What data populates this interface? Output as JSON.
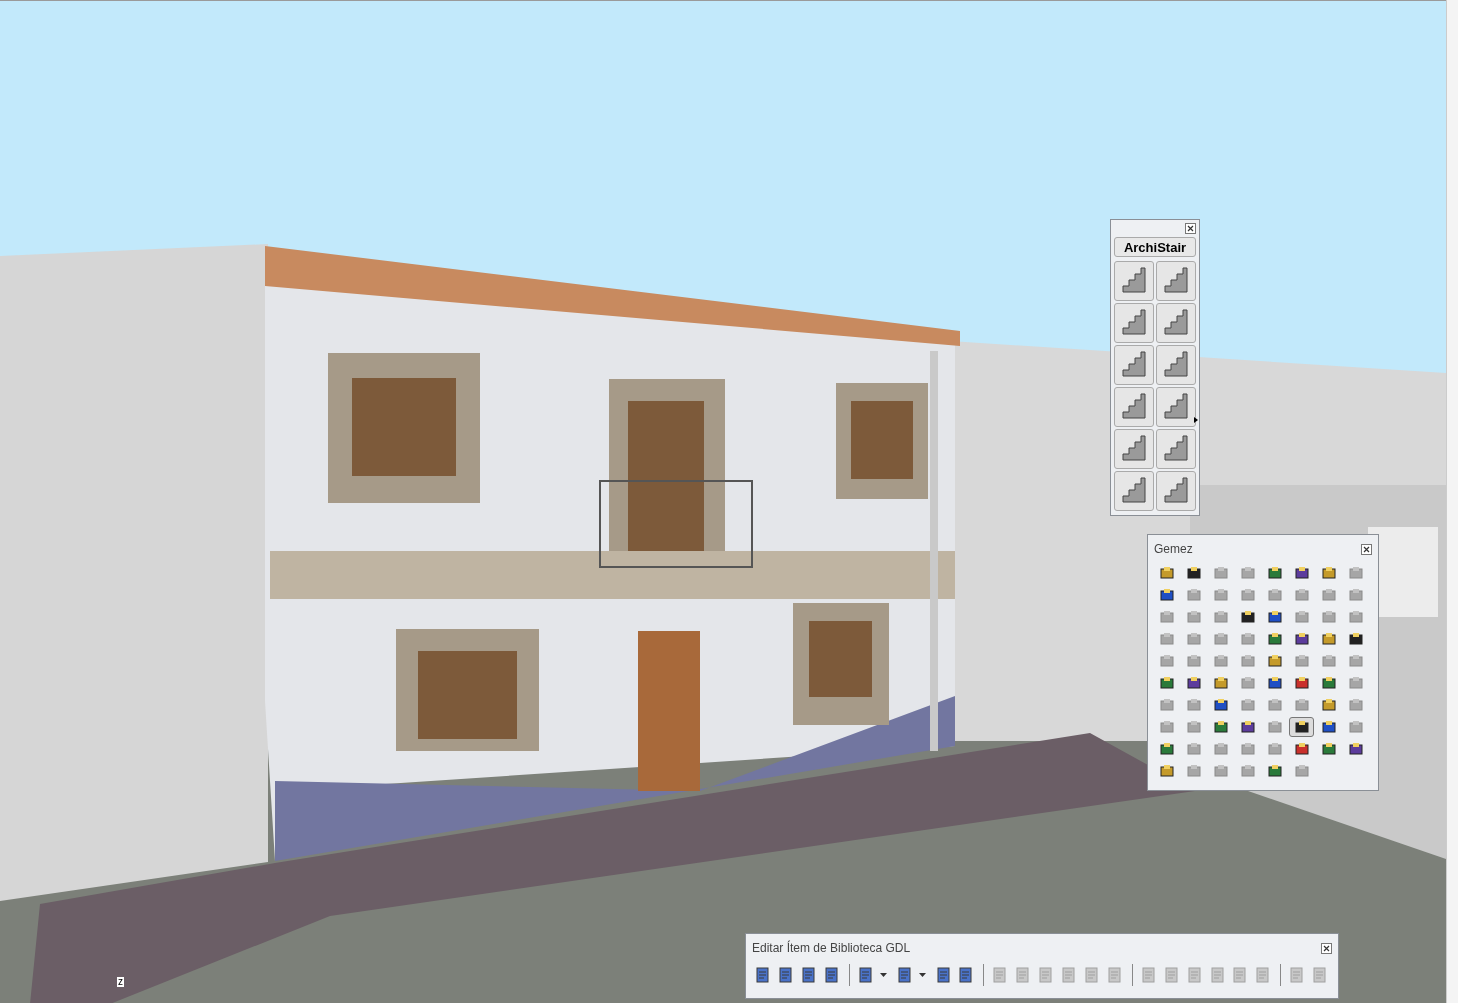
{
  "viewport": {
    "axis_label": "z"
  },
  "archistair_palette": {
    "title": "ArchiStair",
    "buttons": [
      {
        "submenu": false
      },
      {
        "submenu": false
      },
      {
        "submenu": false
      },
      {
        "submenu": false
      },
      {
        "submenu": false
      },
      {
        "submenu": false
      },
      {
        "submenu": false
      },
      {
        "submenu": true
      },
      {
        "submenu": false
      },
      {
        "submenu": false
      },
      {
        "submenu": false
      },
      {
        "submenu": false
      }
    ]
  },
  "gemez_palette": {
    "title": "Gemez",
    "rows": [
      [
        {
          "disabled": false,
          "pressed": false
        },
        {
          "disabled": false,
          "pressed": false
        },
        {
          "disabled": true,
          "pressed": false
        },
        {
          "disabled": true,
          "pressed": false
        },
        {
          "disabled": false,
          "pressed": false
        },
        {
          "disabled": false,
          "pressed": false
        },
        {
          "disabled": false,
          "pressed": false
        },
        {
          "disabled": true,
          "pressed": false
        }
      ],
      [
        {
          "disabled": false,
          "pressed": false
        },
        {
          "disabled": true,
          "pressed": false
        },
        {
          "disabled": true,
          "pressed": false
        },
        {
          "disabled": true,
          "pressed": false
        },
        {
          "disabled": true,
          "pressed": false
        },
        {
          "disabled": true,
          "pressed": false
        },
        {
          "disabled": true,
          "pressed": false
        },
        {
          "disabled": true,
          "pressed": false
        }
      ],
      [
        {
          "disabled": true,
          "pressed": false
        },
        {
          "disabled": true,
          "pressed": false
        },
        {
          "disabled": true,
          "pressed": false
        },
        {
          "disabled": false,
          "pressed": false
        },
        {
          "disabled": false,
          "pressed": false
        },
        {
          "disabled": true,
          "pressed": false
        },
        {
          "disabled": true,
          "pressed": false
        },
        {
          "disabled": true,
          "pressed": false
        }
      ],
      [
        {
          "disabled": true,
          "pressed": false
        },
        {
          "disabled": true,
          "pressed": false
        },
        {
          "disabled": true,
          "pressed": false
        },
        {
          "disabled": true,
          "pressed": false
        },
        {
          "disabled": false,
          "pressed": false
        },
        {
          "disabled": false,
          "pressed": false
        },
        {
          "disabled": false,
          "pressed": false
        },
        {
          "disabled": false,
          "pressed": false
        }
      ],
      [
        {
          "disabled": true,
          "pressed": false
        },
        {
          "disabled": true,
          "pressed": false
        },
        {
          "disabled": true,
          "pressed": false
        },
        {
          "disabled": true,
          "pressed": false
        },
        {
          "disabled": false,
          "pressed": false
        },
        {
          "disabled": true,
          "pressed": false
        },
        {
          "disabled": true,
          "pressed": false
        },
        {
          "disabled": true,
          "pressed": false
        }
      ],
      [
        {
          "disabled": false,
          "pressed": false
        },
        {
          "disabled": false,
          "pressed": false
        },
        {
          "disabled": false,
          "pressed": false
        },
        {
          "disabled": true,
          "pressed": false
        },
        {
          "disabled": false,
          "pressed": false
        },
        {
          "disabled": false,
          "pressed": false
        },
        {
          "disabled": false,
          "pressed": false
        },
        {
          "disabled": true,
          "pressed": false
        }
      ],
      [
        {
          "disabled": true,
          "pressed": false
        },
        {
          "disabled": true,
          "pressed": false
        },
        {
          "disabled": false,
          "pressed": false
        },
        {
          "disabled": true,
          "pressed": false
        },
        {
          "disabled": true,
          "pressed": false
        },
        {
          "disabled": true,
          "pressed": false
        },
        {
          "disabled": false,
          "pressed": false
        },
        {
          "disabled": true,
          "pressed": false
        }
      ],
      [
        {
          "disabled": true,
          "pressed": false
        },
        {
          "disabled": true,
          "pressed": false
        },
        {
          "disabled": false,
          "pressed": false
        },
        {
          "disabled": false,
          "pressed": false
        },
        {
          "disabled": true,
          "pressed": false
        },
        {
          "disabled": false,
          "pressed": true
        },
        {
          "disabled": false,
          "pressed": false
        },
        {
          "disabled": true,
          "pressed": false
        }
      ],
      [
        {
          "disabled": false,
          "pressed": false
        },
        {
          "disabled": true,
          "pressed": false
        },
        {
          "disabled": true,
          "pressed": false
        },
        {
          "disabled": true,
          "pressed": false
        },
        {
          "disabled": true,
          "pressed": false
        },
        {
          "disabled": false,
          "pressed": false
        },
        {
          "disabled": false,
          "pressed": false
        },
        {
          "disabled": false,
          "pressed": false
        }
      ],
      [
        {
          "disabled": false,
          "pressed": false
        },
        {
          "disabled": true,
          "pressed": false
        },
        {
          "disabled": true,
          "pressed": false
        },
        {
          "disabled": true,
          "pressed": false
        },
        {
          "disabled": false,
          "pressed": false
        },
        {
          "disabled": true,
          "pressed": false
        }
      ]
    ]
  },
  "gdl_toolbar": {
    "title": "Editar Ítem de Biblioteca GDL",
    "groups": [
      [
        {
          "kind": "button",
          "disabled": false
        },
        {
          "kind": "button",
          "disabled": false
        },
        {
          "kind": "button",
          "disabled": false
        },
        {
          "kind": "button",
          "disabled": false
        }
      ],
      [
        {
          "kind": "dropdown",
          "disabled": false
        },
        {
          "kind": "dropdown",
          "disabled": false
        },
        {
          "kind": "button",
          "disabled": false
        },
        {
          "kind": "button",
          "disabled": false
        }
      ],
      [
        {
          "kind": "button",
          "disabled": true
        },
        {
          "kind": "button",
          "disabled": true
        },
        {
          "kind": "button",
          "disabled": true
        },
        {
          "kind": "button",
          "disabled": true
        },
        {
          "kind": "button",
          "disabled": true
        },
        {
          "kind": "button",
          "disabled": true
        }
      ],
      [
        {
          "kind": "button",
          "disabled": true
        },
        {
          "kind": "button",
          "disabled": true
        },
        {
          "kind": "button",
          "disabled": true
        },
        {
          "kind": "button",
          "disabled": true
        },
        {
          "kind": "button",
          "disabled": true
        },
        {
          "kind": "button",
          "disabled": true
        }
      ],
      [
        {
          "kind": "button",
          "disabled": true
        },
        {
          "kind": "button",
          "disabled": true
        }
      ]
    ]
  }
}
